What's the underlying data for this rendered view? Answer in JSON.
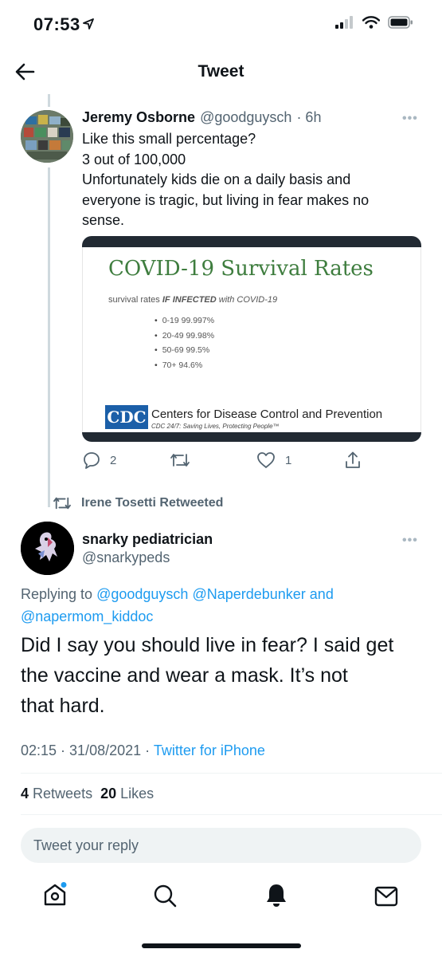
{
  "status_bar": {
    "time": "07:53",
    "icons": [
      "location-arrow-icon",
      "signal-icon",
      "wifi-icon",
      "battery-icon"
    ]
  },
  "header": {
    "title": "Tweet",
    "back_icon": "arrow-left-icon"
  },
  "parent_tweet": {
    "author_name": "Jeremy Osborne",
    "author_handle": "@goodguysch",
    "time_ago": "· 6h",
    "text_lines": [
      "Like this small percentage?",
      "3 out of 100,000",
      "Unfortunately kids die on a daily basis and",
      "everyone is tragic, but living in fear makes no",
      "sense."
    ],
    "image": {
      "title": "COVID-19 Survival Rates",
      "subtitle_prefix": "survival rates ",
      "subtitle_emphasis": "IF INFECTED",
      "subtitle_suffix": " with COVID-19",
      "rates": [
        "0-19 99.997%",
        "20-49 99.98%",
        "50-69 99.5%",
        "70+ 94.6%"
      ],
      "logo_text": "CDC",
      "org_name": "Centers for Disease Control and Prevention",
      "tagline": "CDC 24/7: Saving Lives, Protecting People™"
    },
    "actions": {
      "replies": "2",
      "retweets": "",
      "likes": "1"
    }
  },
  "retweet_context": {
    "text": "Irene Tosetti Retweeted"
  },
  "main_tweet": {
    "author_name": "snarky pediatrician",
    "author_handle": "@snarkypeds",
    "replying_prefix": "Replying to ",
    "replying_to_1": "@goodguysch",
    "replying_to_2": "@Naperdebunker",
    "replying_and": " and",
    "replying_to_3": "@napermom_kiddoc",
    "text_lines": [
      "Did I say you should live in fear? I said get",
      "the vaccine and wear a mask. It’s not",
      "that hard."
    ],
    "timestamp": "02:15 · 31/08/2021 · ",
    "source": "Twitter for iPhone",
    "retweets_count": "4",
    "retweets_label": "Retweets",
    "likes_count": "20",
    "likes_label": "Likes"
  },
  "reply_box": {
    "placeholder": "Tweet your reply"
  },
  "tab_bar": {
    "items": [
      "home-icon",
      "search-icon",
      "notifications-icon",
      "messages-icon"
    ]
  },
  "colors": {
    "accent": "#1d9bf0",
    "muted": "#536471",
    "cdc_green": "#3e7d3e",
    "cdc_blue": "#1b5fa8"
  }
}
